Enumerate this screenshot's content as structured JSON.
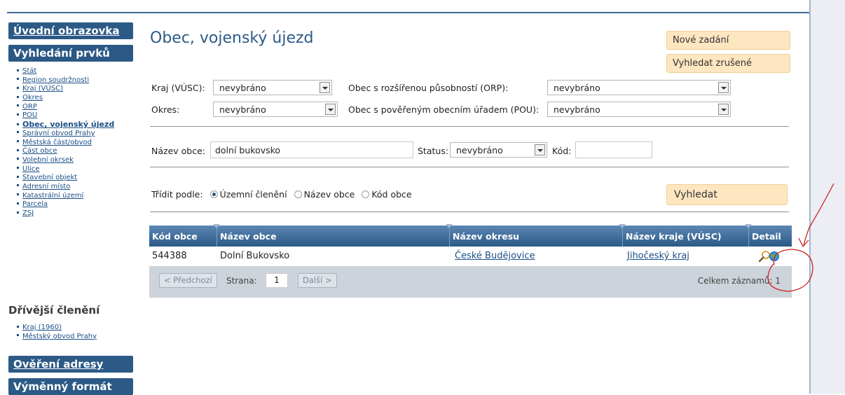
{
  "sidebar": {
    "sections": {
      "uvodni": "Úvodní obrazovka",
      "vyhledani": "Vyhledání prvků",
      "drivejsi": "Dřívější členění",
      "overeni": "Ověření adresy",
      "vymenny": "Výměnný formát"
    },
    "items": [
      "Stát",
      "Region soudržnosti",
      "Kraj (VÚSC)",
      "Okres",
      "ORP",
      "POU",
      "Obec, vojenský újezd",
      "Správní obvod Prahy",
      "Městská část/obvod",
      "Část obce",
      "Volební okrsek",
      "Ulice",
      "Stavební objekt",
      "Adresní místo",
      "Katastrální území",
      "Parcela",
      "ZSJ"
    ],
    "items_old": [
      "Kraj (1960)",
      "Městský obvod Prahy"
    ]
  },
  "main": {
    "title": "Obec, vojenský újezd",
    "buttons": {
      "nove_zadani": "Nové zadání",
      "vyhledat_zrusene": "Vyhledat zrušené",
      "vyhledat": "Vyhledat"
    },
    "filters": {
      "kraj_label": "Kraj (VÚSC):",
      "kraj_value": "nevybráno",
      "okres_label": "Okres:",
      "okres_value": "nevybráno",
      "orp_label": "Obec s rozšířenou působností (ORP):",
      "orp_value": "nevybráno",
      "pou_label": "Obec s pověřeným obecním úřadem (POU):",
      "pou_value": "nevybráno",
      "nazev_label": "Název obce:",
      "nazev_value": "dolní bukovsko",
      "status_label": "Status:",
      "status_value": "nevybráno",
      "kod_label": "Kód:",
      "kod_value": ""
    },
    "sort": {
      "label": "Třídit podle:",
      "options": [
        "Územní členění",
        "Název obce",
        "Kód obce"
      ],
      "selected": "Územní členění"
    },
    "table": {
      "headers": [
        "Kód obce",
        "Název obce",
        "Název okresu",
        "Název kraje (VÚSC)",
        "Detail"
      ],
      "rows": [
        {
          "kod": "544388",
          "nazev": "Dolní Bukovsko",
          "okres": "České Budějovice",
          "kraj": "Jihočeský kraj"
        }
      ]
    },
    "pager": {
      "prev": "< Předchozí",
      "page_label": "Strana:",
      "page": "1",
      "next": "Další >",
      "total_label": "Celkem záznamů: 1"
    }
  },
  "colors": {
    "accent": "#2c5a86",
    "orange_btn": "#fde6c0",
    "annotation": "#cc2222"
  },
  "icons": [
    "magnifier-icon",
    "globe-icon",
    "sort-arrow-icon",
    "dropdown-arrow-icon"
  ]
}
